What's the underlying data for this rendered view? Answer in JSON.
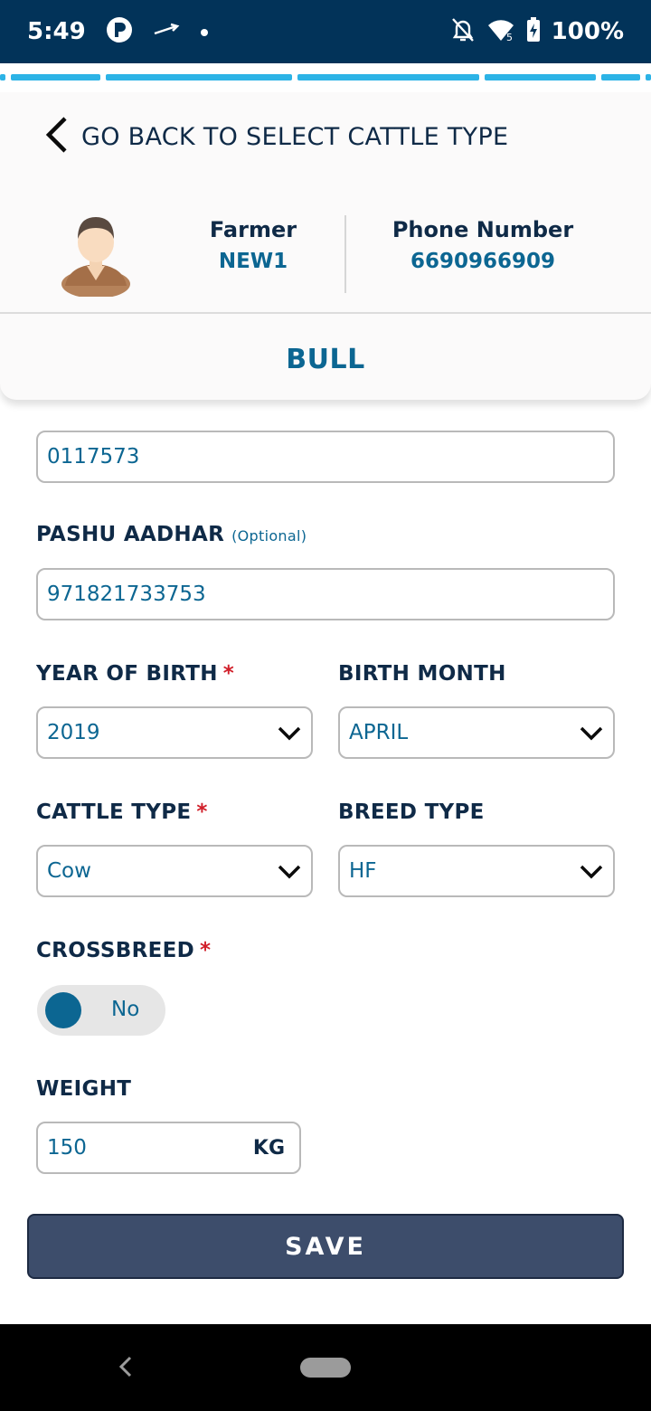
{
  "status_bar": {
    "time": "5:49",
    "battery": "100%",
    "icons": [
      "p-icon",
      "airplane-arrow-icon",
      "dot-icon",
      "bell-off-icon",
      "wifi-icon",
      "battery-charging-icon"
    ]
  },
  "header": {
    "back_label": "GO BACK TO SELECT CATTLE TYPE",
    "farmer_label": "Farmer",
    "farmer_value": "NEW1",
    "phone_label": "Phone Number",
    "phone_value": "6690966909",
    "cattle_title": "BULL"
  },
  "form": {
    "tag_number_value": "0117573",
    "pashu_aadhar_label": "PASHU AADHAR",
    "pashu_aadhar_optional": "(Optional)",
    "pashu_aadhar_value": "971821733753",
    "year_of_birth_label": "YEAR OF BIRTH",
    "year_of_birth_value": "2019",
    "birth_month_label": "BIRTH MONTH",
    "birth_month_value": "APRIL",
    "cattle_type_label": "CATTLE TYPE",
    "cattle_type_value": "Cow",
    "breed_type_label": "BREED TYPE",
    "breed_type_value": "HF",
    "crossbreed_label": "CROSSBREED",
    "crossbreed_value": "No",
    "weight_label": "WEIGHT",
    "weight_value": "150",
    "weight_unit": "KG",
    "required_mark": "*"
  },
  "actions": {
    "save_label": "SAVE"
  },
  "colors": {
    "status_bar": "#023359",
    "accent": "#0c6692",
    "progress": "#2cb3e6",
    "save_button": "#3d4d6b",
    "required": "#d11f2a"
  }
}
